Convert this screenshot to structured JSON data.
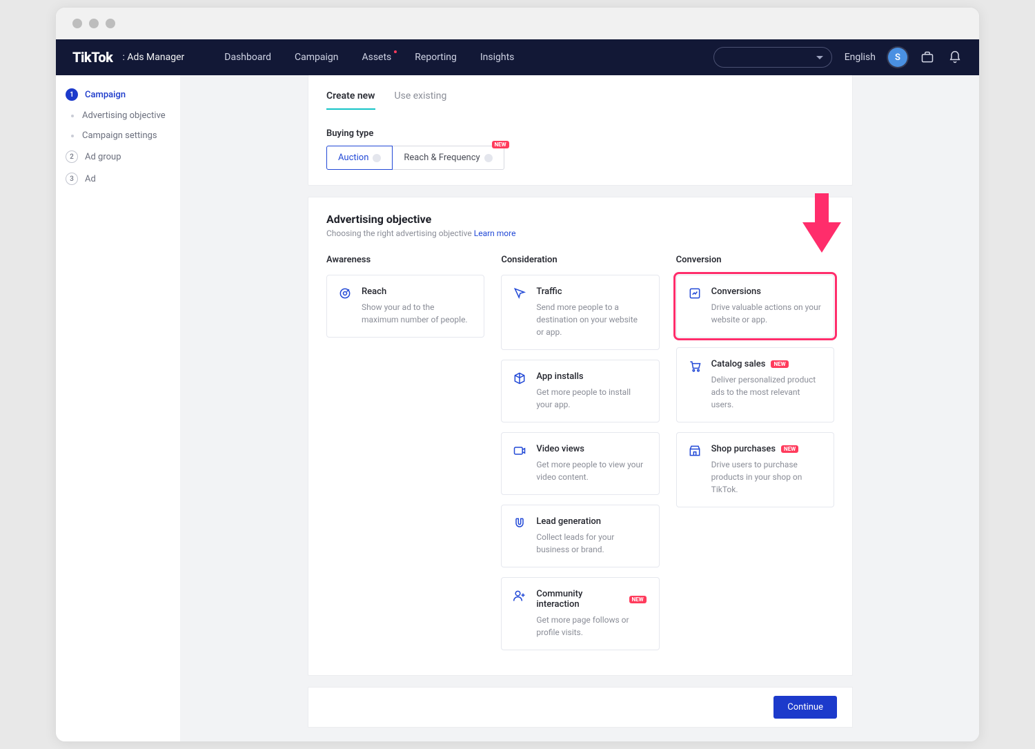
{
  "brand": {
    "name": "TikTok",
    "sub": ": Ads Manager"
  },
  "nav": {
    "dashboard": "Dashboard",
    "campaign": "Campaign",
    "assets": "Assets",
    "reporting": "Reporting",
    "insights": "Insights"
  },
  "header": {
    "language": "English",
    "avatar_initial": "S"
  },
  "sidebar": {
    "step1": "Campaign",
    "step1a": "Advertising objective",
    "step1b": "Campaign settings",
    "step2": "Ad group",
    "step3": "Ad"
  },
  "tabs": {
    "create": "Create new",
    "existing": "Use existing"
  },
  "buying": {
    "label": "Buying type",
    "auction": "Auction",
    "rf": "Reach & Frequency",
    "new": "NEW"
  },
  "objective": {
    "title": "Advertising objective",
    "hint": "Choosing the right advertising objective ",
    "learn": "Learn more",
    "cols": {
      "awareness": "Awareness",
      "consideration": "Consideration",
      "conversion": "Conversion"
    },
    "reach": {
      "t": "Reach",
      "d": "Show your ad to the maximum number of people."
    },
    "traffic": {
      "t": "Traffic",
      "d": "Send more people to a destination on your website or app."
    },
    "appinstalls": {
      "t": "App installs",
      "d": "Get more people to install your app."
    },
    "videoviews": {
      "t": "Video views",
      "d": "Get more people to view your video content."
    },
    "leadgen": {
      "t": "Lead generation",
      "d": "Collect leads for your business or brand."
    },
    "community": {
      "t": "Community interaction",
      "d": "Get more page follows or profile visits."
    },
    "conversions": {
      "t": "Conversions",
      "d": "Drive valuable actions on your website or app."
    },
    "catalog": {
      "t": "Catalog sales",
      "d": "Deliver personalized product ads to the most relevant users."
    },
    "shop": {
      "t": "Shop purchases",
      "d": "Drive users to purchase products in your shop on TikTok."
    },
    "new": "NEW"
  },
  "footer": {
    "continue": "Continue"
  }
}
